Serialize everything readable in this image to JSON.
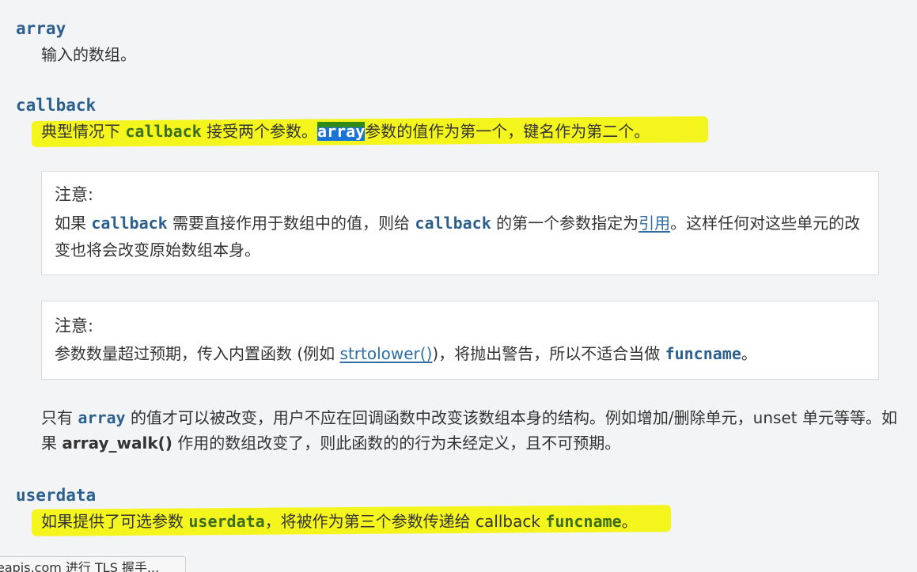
{
  "params": {
    "array": {
      "term": "array",
      "desc": "输入的数组。"
    },
    "callback": {
      "term": "callback",
      "desc_p1": "典型情况下",
      "desc_code1": "callback",
      "desc_p2": "接受两个参数。",
      "desc_code2": "array",
      "desc_p3": "参数的值作为第一个，键名作为第二个。"
    },
    "userdata": {
      "term": "userdata",
      "desc_p1": "如果提供了可选参数",
      "desc_code1": "userdata",
      "desc_p2": "，将被作为第三个参数传递给 callback",
      "desc_code2": "funcname",
      "desc_p3": "。"
    }
  },
  "notes": [
    {
      "title": "注意:",
      "body_p1": "如果",
      "body_code1": "callback",
      "body_p2": "需要直接作用于数组中的值，则给",
      "body_code2": "callback",
      "body_p3": "的第一个参数指定为",
      "body_link": "引用",
      "body_p4": "。这样任何对这些单元的改变也将会改变原始数组本身。"
    },
    {
      "title": "注意:",
      "body_p1": "参数数量超过预期，传入内置函数 (例如 ",
      "body_link": "strtolower()",
      "body_p2": ")，将抛出警告，所以不适合当做",
      "body_code1": "funcname",
      "body_p3": "。"
    }
  ],
  "paragraph": {
    "p1": "只有",
    "code1": "array",
    "p2": "的值才可以被改变，用户不应在回调函数中改变该数组本身的结构。例如增加/删除单元，unset 单元等等。如果",
    "func": "array_walk()",
    "p3": "作用的数组改变了，则此函数的的行为未经定义，且不可预期。"
  },
  "status_bar": {
    "text": "eapis.com 进行 TLS 握手..."
  },
  "colors": {
    "highlight": "#f5f51e",
    "selection": "#1a73d9",
    "term": "#2b5f8e",
    "code_green": "#3b6e1a",
    "link": "#2e6ea5"
  }
}
